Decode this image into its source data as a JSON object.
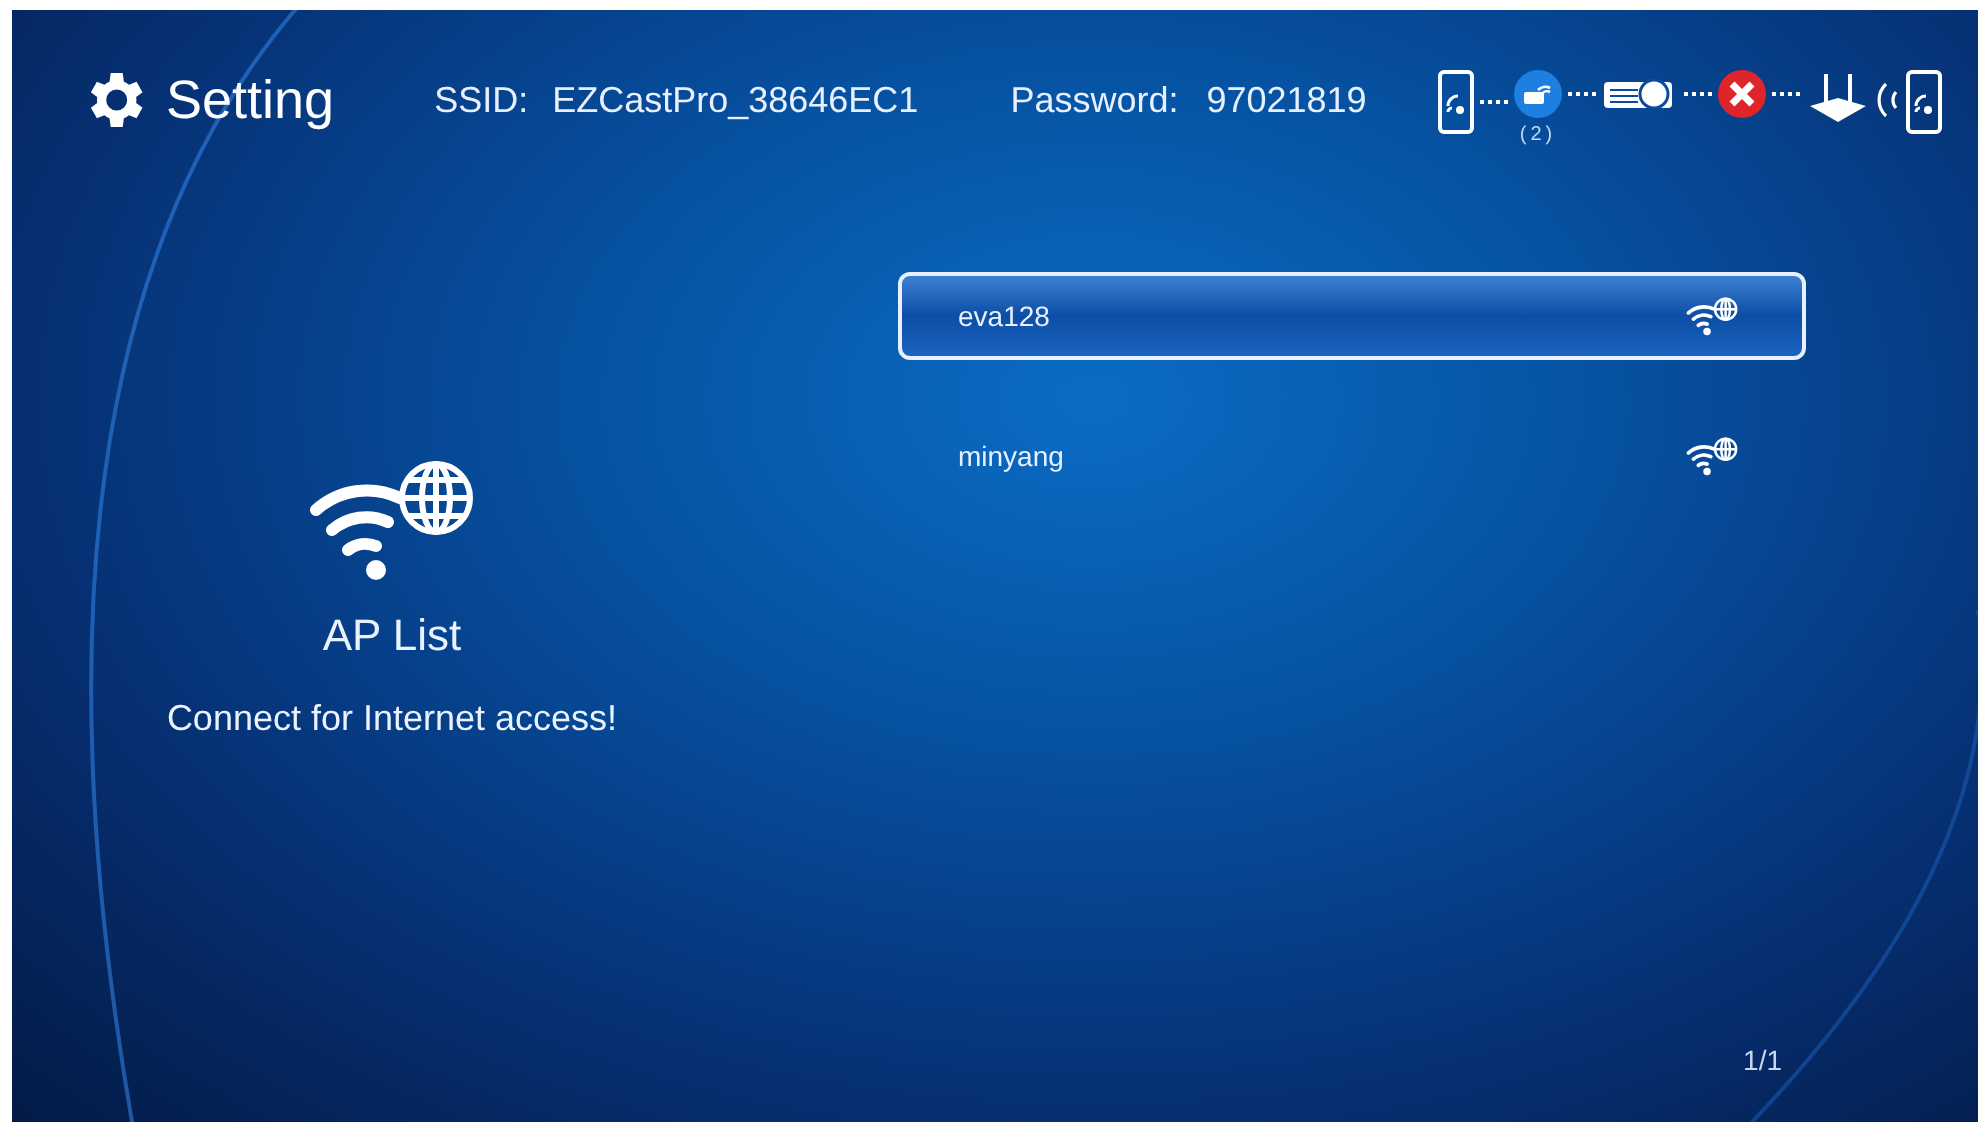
{
  "header": {
    "title": "Setting",
    "ssid_label": "SSID:",
    "ssid": "EZCastPro_38646EC1",
    "password_label": "Password:",
    "password": "97021819"
  },
  "status": {
    "device_count": "(2)",
    "internet_ok": false
  },
  "info": {
    "title": "AP List",
    "subtitle": "Connect for Internet access!"
  },
  "ap_list": [
    {
      "name": "eva128",
      "selected": true
    },
    {
      "name": "minyang",
      "selected": false
    }
  ],
  "page": "1/1"
}
